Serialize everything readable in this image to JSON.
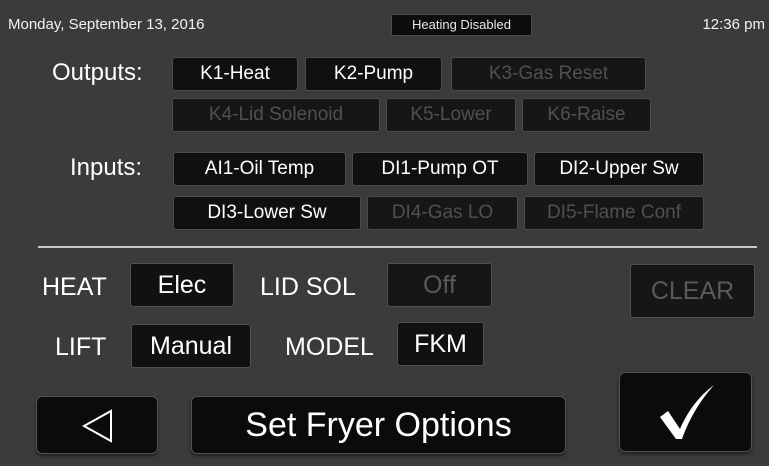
{
  "status": {
    "date": "Monday, September 13, 2016",
    "badge": "Heating Disabled",
    "time": "12:36 pm"
  },
  "outputs": {
    "label": "Outputs:",
    "items": [
      {
        "label": "K1-Heat",
        "active": true
      },
      {
        "label": "K2-Pump",
        "active": true
      },
      {
        "label": "K3-Gas Reset",
        "active": false
      },
      {
        "label": "K4-Lid Solenoid",
        "active": false
      },
      {
        "label": "K5-Lower",
        "active": false
      },
      {
        "label": "K6-Raise",
        "active": false
      }
    ]
  },
  "inputs": {
    "label": "Inputs:",
    "items": [
      {
        "label": "AI1-Oil Temp",
        "active": true
      },
      {
        "label": "DI1-Pump OT",
        "active": true
      },
      {
        "label": "DI2-Upper Sw",
        "active": true
      },
      {
        "label": "DI3-Lower Sw",
        "active": true
      },
      {
        "label": "DI4-Gas LO",
        "active": false
      },
      {
        "label": "DI5-Flame Conf",
        "active": false
      }
    ]
  },
  "options": {
    "heat": {
      "label": "HEAT",
      "value": "Elec"
    },
    "lid_sol": {
      "label": "LID SOL",
      "value": "Off"
    },
    "clear_label": "CLEAR",
    "lift": {
      "label": "LIFT",
      "value": "Manual"
    },
    "model": {
      "label": "MODEL",
      "value": "FKM"
    }
  },
  "bottom": {
    "title": "Set Fryer Options",
    "back_icon": "back-triangle-icon",
    "confirm_icon": "checkmark-icon"
  },
  "colors": {
    "background": "#3b3b3b",
    "button": "#101010",
    "inactive_text": "#505050"
  }
}
